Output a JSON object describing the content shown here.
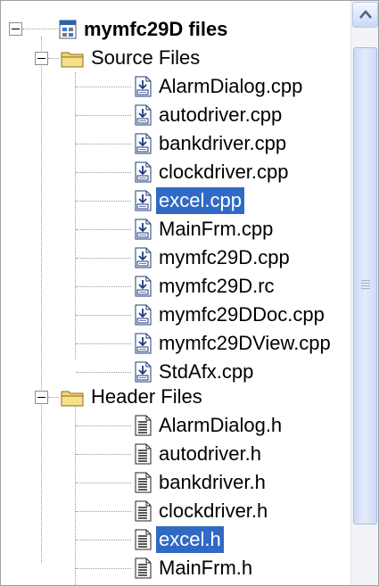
{
  "root": {
    "label": "mymfc29D files",
    "icon": "project-icon"
  },
  "source_folder": {
    "label": "Source Files",
    "icon": "folder-icon"
  },
  "source_files": [
    {
      "name": "AlarmDialog.cpp",
      "selected": false
    },
    {
      "name": "autodriver.cpp",
      "selected": false
    },
    {
      "name": "bankdriver.cpp",
      "selected": false
    },
    {
      "name": "clockdriver.cpp",
      "selected": false
    },
    {
      "name": "excel.cpp",
      "selected": true
    },
    {
      "name": "MainFrm.cpp",
      "selected": false
    },
    {
      "name": "mymfc29D.cpp",
      "selected": false
    },
    {
      "name": "mymfc29D.rc",
      "selected": false
    },
    {
      "name": "mymfc29DDoc.cpp",
      "selected": false
    },
    {
      "name": "mymfc29DView.cpp",
      "selected": false
    },
    {
      "name": "StdAfx.cpp",
      "selected": false
    }
  ],
  "header_folder": {
    "label": "Header Files",
    "icon": "folder-icon"
  },
  "header_files": [
    {
      "name": "AlarmDialog.h",
      "selected": false
    },
    {
      "name": "autodriver.h",
      "selected": false
    },
    {
      "name": "bankdriver.h",
      "selected": false
    },
    {
      "name": "clockdriver.h",
      "selected": false
    },
    {
      "name": "excel.h",
      "selected": true
    },
    {
      "name": "MainFrm.h",
      "selected": false
    }
  ],
  "colors": {
    "selection": "#316ac5",
    "folder": "#f2d46b",
    "scrollbar_thumb": "#cdd9f6"
  },
  "icons": {
    "expanded": "minus-box-icon",
    "cpp_file": "cpp-file-icon",
    "header_file": "header-file-icon",
    "scroll_up": "arrow-up-icon"
  }
}
